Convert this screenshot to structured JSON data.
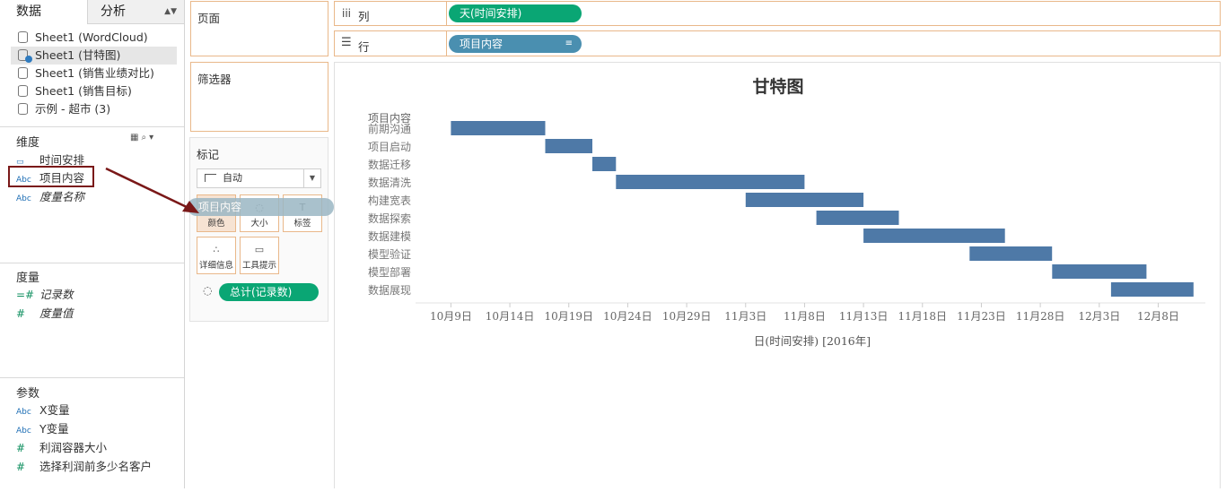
{
  "tabs": {
    "data": "数据",
    "analysis": "分析"
  },
  "datasources": [
    {
      "label": "Sheet1 (WordCloud)",
      "selected": false
    },
    {
      "label": "Sheet1 (甘特图)",
      "selected": true
    },
    {
      "label": "Sheet1 (销售业绩对比)",
      "selected": false
    },
    {
      "label": "Sheet1 (销售目标)",
      "selected": false
    },
    {
      "label": "示例 - 超市 (3)",
      "selected": false
    }
  ],
  "dimensions": {
    "title": "维度",
    "items": [
      {
        "icon": "calendar-icon",
        "label": "时间安排"
      },
      {
        "icon": "abc-icon",
        "icon_text": "Abc",
        "label": "项目内容"
      },
      {
        "icon": "abc-icon",
        "icon_text": "Abc",
        "label": "度量名称"
      }
    ]
  },
  "measures": {
    "title": "度量",
    "items": [
      {
        "icon": "hash-icon",
        "icon_text": "=#",
        "label": "记录数"
      },
      {
        "icon": "hash-icon",
        "icon_text": "#",
        "label": "度量值"
      }
    ]
  },
  "parameters": {
    "title": "参数",
    "items": [
      {
        "icon": "abc-icon",
        "icon_text": "Abc",
        "label": "X变量"
      },
      {
        "icon": "abc-icon",
        "icon_text": "Abc",
        "label": "Y变量"
      },
      {
        "icon": "hash-icon",
        "icon_text": "#",
        "label": "利润容器大小"
      },
      {
        "icon": "hash-icon",
        "icon_text": "#",
        "label": "选择利润前多少名客户"
      }
    ]
  },
  "cards": {
    "pages": "页面",
    "filters": "筛选器",
    "marks": "标记"
  },
  "marks": {
    "type": "自动",
    "buttons": {
      "color": "颜色",
      "size": "大小",
      "label": "标签",
      "detail": "详细信息",
      "tooltip": "工具提示"
    },
    "drag_pill": "项目内容",
    "size_pill": "总计(记录数)"
  },
  "shelves": {
    "columns_label": "列",
    "rows_label": "行",
    "columns_pill": "天(时间安排)",
    "rows_pill": "项目内容"
  },
  "colors": {
    "bar": "#4e79a7",
    "green_pill": "#0aa674",
    "blue_pill": "#4a8fb0",
    "highlight": "#7a1818"
  },
  "chart_data": {
    "type": "bar",
    "title": "甘特图",
    "xlabel": "日(时间安排) [2016年]",
    "ylabel": "项目内容",
    "categories": [
      "前期沟通",
      "项目启动",
      "数据迁移",
      "数据清洗",
      "构建宽表",
      "数据探索",
      "数据建模",
      "模型验证",
      "模型部署",
      "数据展现"
    ],
    "series": [
      {
        "starts": [
          "2016-10-09",
          "2016-10-17",
          "2016-10-21",
          "2016-10-23",
          "2016-11-03",
          "2016-11-09",
          "2016-11-13",
          "2016-11-22",
          "2016-11-29",
          "2016-12-04"
        ],
        "ends": [
          "2016-10-17",
          "2016-10-21",
          "2016-10-23",
          "2016-11-08",
          "2016-11-13",
          "2016-11-16",
          "2016-11-25",
          "2016-11-29",
          "2016-12-07",
          "2016-12-11"
        ]
      }
    ],
    "x_ticks": [
      "10月9日",
      "10月14日",
      "10月19日",
      "10月24日",
      "10月29日",
      "11月3日",
      "11月8日",
      "11月13日",
      "11月18日",
      "11月23日",
      "11月28日",
      "12月3日",
      "12月8日"
    ],
    "x_tick_dates": [
      "2016-10-09",
      "2016-10-14",
      "2016-10-19",
      "2016-10-24",
      "2016-10-29",
      "2016-11-03",
      "2016-11-08",
      "2016-11-13",
      "2016-11-18",
      "2016-11-23",
      "2016-11-28",
      "2016-12-03",
      "2016-12-08"
    ],
    "xlim": [
      "2016-10-06",
      "2016-12-12"
    ],
    "grid": false
  }
}
